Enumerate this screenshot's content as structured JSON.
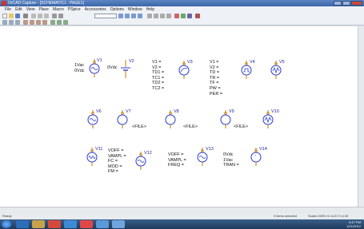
{
  "window": {
    "title": "OrCAD Capture - [SCHEMATIC1 : PAGE1]"
  },
  "menus": [
    "File",
    "Edit",
    "View",
    "Place",
    "Macro",
    "PSpice",
    "Accessories",
    "Options",
    "Window",
    "Help"
  ],
  "toolbar": {
    "zoom_value": ""
  },
  "colors": {
    "part": "#2a3bd4",
    "pin": "#c47a00",
    "text": "#111111"
  },
  "components": [
    {
      "ref": "V1",
      "props": "1Vac\n0Vdc",
      "kind": "sine"
    },
    {
      "ref": "V2",
      "props": "0Vdc",
      "kind": "battery"
    },
    {
      "ref": "V3",
      "props": "V1 =\nV2 =\nTD1 =\nTC1 =\nTD2 =\nTC2 =",
      "kind": "exp"
    },
    {
      "ref": "V4",
      "props": "V1 =\nV2 =\nTD =\nTR =\nTF =\nPW =\nPER =",
      "kind": "pulse"
    },
    {
      "ref": "V5",
      "props": "",
      "kind": "pwl"
    },
    {
      "ref": "V6",
      "props": "",
      "kind": "sine"
    },
    {
      "ref": "V7",
      "props": "<FILE>",
      "kind": "file"
    },
    {
      "ref": "V8",
      "props": "<FILE>",
      "kind": "file"
    },
    {
      "ref": "V9",
      "props": "<FILE>",
      "kind": "file"
    },
    {
      "ref": "V10",
      "props": "",
      "kind": "pwl"
    },
    {
      "ref": "V11",
      "props": "VOFF =\nVAMPL =\nFC =\nMOD =\nFM =",
      "kind": "sine"
    },
    {
      "ref": "V12",
      "props": "",
      "kind": "sine"
    },
    {
      "ref": "V13",
      "props": "VOFF =\nVAMPL =\nFREQ =",
      "kind": "sine"
    },
    {
      "ref": "V14",
      "props": "0Vdc\n1Vac\nTRAN =",
      "kind": "plain"
    }
  ],
  "status": {
    "left": "Ready",
    "items": "0 items selected",
    "scale": "Scale=200%  X=4.20  Y=4.00"
  },
  "taskbar": {
    "time": "9:47 PM",
    "date": "12/1/2012"
  }
}
